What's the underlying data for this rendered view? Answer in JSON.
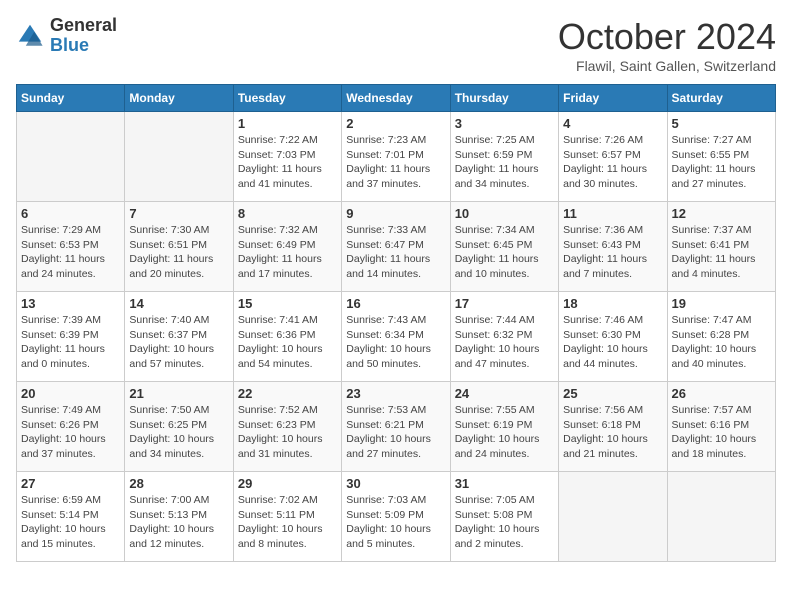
{
  "header": {
    "logo_general": "General",
    "logo_blue": "Blue",
    "month": "October 2024",
    "location": "Flawil, Saint Gallen, Switzerland"
  },
  "days_of_week": [
    "Sunday",
    "Monday",
    "Tuesday",
    "Wednesday",
    "Thursday",
    "Friday",
    "Saturday"
  ],
  "weeks": [
    [
      {
        "day": "",
        "empty": true
      },
      {
        "day": "",
        "empty": true
      },
      {
        "day": "1",
        "sunrise": "7:22 AM",
        "sunset": "7:03 PM",
        "daylight": "11 hours and 41 minutes."
      },
      {
        "day": "2",
        "sunrise": "7:23 AM",
        "sunset": "7:01 PM",
        "daylight": "11 hours and 37 minutes."
      },
      {
        "day": "3",
        "sunrise": "7:25 AM",
        "sunset": "6:59 PM",
        "daylight": "11 hours and 34 minutes."
      },
      {
        "day": "4",
        "sunrise": "7:26 AM",
        "sunset": "6:57 PM",
        "daylight": "11 hours and 30 minutes."
      },
      {
        "day": "5",
        "sunrise": "7:27 AM",
        "sunset": "6:55 PM",
        "daylight": "11 hours and 27 minutes."
      }
    ],
    [
      {
        "day": "6",
        "sunrise": "7:29 AM",
        "sunset": "6:53 PM",
        "daylight": "11 hours and 24 minutes."
      },
      {
        "day": "7",
        "sunrise": "7:30 AM",
        "sunset": "6:51 PM",
        "daylight": "11 hours and 20 minutes."
      },
      {
        "day": "8",
        "sunrise": "7:32 AM",
        "sunset": "6:49 PM",
        "daylight": "11 hours and 17 minutes."
      },
      {
        "day": "9",
        "sunrise": "7:33 AM",
        "sunset": "6:47 PM",
        "daylight": "11 hours and 14 minutes."
      },
      {
        "day": "10",
        "sunrise": "7:34 AM",
        "sunset": "6:45 PM",
        "daylight": "11 hours and 10 minutes."
      },
      {
        "day": "11",
        "sunrise": "7:36 AM",
        "sunset": "6:43 PM",
        "daylight": "11 hours and 7 minutes."
      },
      {
        "day": "12",
        "sunrise": "7:37 AM",
        "sunset": "6:41 PM",
        "daylight": "11 hours and 4 minutes."
      }
    ],
    [
      {
        "day": "13",
        "sunrise": "7:39 AM",
        "sunset": "6:39 PM",
        "daylight": "11 hours and 0 minutes."
      },
      {
        "day": "14",
        "sunrise": "7:40 AM",
        "sunset": "6:37 PM",
        "daylight": "10 hours and 57 minutes."
      },
      {
        "day": "15",
        "sunrise": "7:41 AM",
        "sunset": "6:36 PM",
        "daylight": "10 hours and 54 minutes."
      },
      {
        "day": "16",
        "sunrise": "7:43 AM",
        "sunset": "6:34 PM",
        "daylight": "10 hours and 50 minutes."
      },
      {
        "day": "17",
        "sunrise": "7:44 AM",
        "sunset": "6:32 PM",
        "daylight": "10 hours and 47 minutes."
      },
      {
        "day": "18",
        "sunrise": "7:46 AM",
        "sunset": "6:30 PM",
        "daylight": "10 hours and 44 minutes."
      },
      {
        "day": "19",
        "sunrise": "7:47 AM",
        "sunset": "6:28 PM",
        "daylight": "10 hours and 40 minutes."
      }
    ],
    [
      {
        "day": "20",
        "sunrise": "7:49 AM",
        "sunset": "6:26 PM",
        "daylight": "10 hours and 37 minutes."
      },
      {
        "day": "21",
        "sunrise": "7:50 AM",
        "sunset": "6:25 PM",
        "daylight": "10 hours and 34 minutes."
      },
      {
        "day": "22",
        "sunrise": "7:52 AM",
        "sunset": "6:23 PM",
        "daylight": "10 hours and 31 minutes."
      },
      {
        "day": "23",
        "sunrise": "7:53 AM",
        "sunset": "6:21 PM",
        "daylight": "10 hours and 27 minutes."
      },
      {
        "day": "24",
        "sunrise": "7:55 AM",
        "sunset": "6:19 PM",
        "daylight": "10 hours and 24 minutes."
      },
      {
        "day": "25",
        "sunrise": "7:56 AM",
        "sunset": "6:18 PM",
        "daylight": "10 hours and 21 minutes."
      },
      {
        "day": "26",
        "sunrise": "7:57 AM",
        "sunset": "6:16 PM",
        "daylight": "10 hours and 18 minutes."
      }
    ],
    [
      {
        "day": "27",
        "sunrise": "6:59 AM",
        "sunset": "5:14 PM",
        "daylight": "10 hours and 15 minutes."
      },
      {
        "day": "28",
        "sunrise": "7:00 AM",
        "sunset": "5:13 PM",
        "daylight": "10 hours and 12 minutes."
      },
      {
        "day": "29",
        "sunrise": "7:02 AM",
        "sunset": "5:11 PM",
        "daylight": "10 hours and 8 minutes."
      },
      {
        "day": "30",
        "sunrise": "7:03 AM",
        "sunset": "5:09 PM",
        "daylight": "10 hours and 5 minutes."
      },
      {
        "day": "31",
        "sunrise": "7:05 AM",
        "sunset": "5:08 PM",
        "daylight": "10 hours and 2 minutes."
      },
      {
        "day": "",
        "empty": true
      },
      {
        "day": "",
        "empty": true
      }
    ]
  ]
}
